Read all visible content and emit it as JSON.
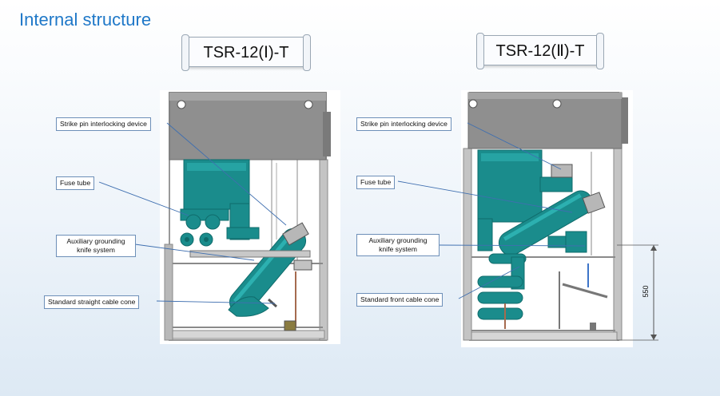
{
  "page_title": "Internal structure",
  "left": {
    "model": "TSR-12(Ⅰ)-T",
    "callouts": {
      "strike_pin": "Strike pin interlocking device",
      "fuse_tube": "Fuse tube",
      "aux_ground_line1": "Auxiliary grounding",
      "aux_ground_line2": "knife system",
      "cable_cone": "Standard straight cable cone"
    }
  },
  "right": {
    "model": "TSR-12(Ⅱ)-T",
    "callouts": {
      "strike_pin": "Strike pin interlocking device",
      "fuse_tube": "Fuse tube",
      "aux_ground_line1": "Auxiliary grounding",
      "aux_ground_line2": "knife system",
      "cable_cone": "Standard front cable cone"
    },
    "dimension": "550"
  },
  "colors": {
    "title": "#1f78c8",
    "teal": "#1a8c8c",
    "teal_dark": "#0f6b6b",
    "frame": "#9a9a9a",
    "box": "#8f8f8f",
    "leader": "#3f6fb0"
  }
}
